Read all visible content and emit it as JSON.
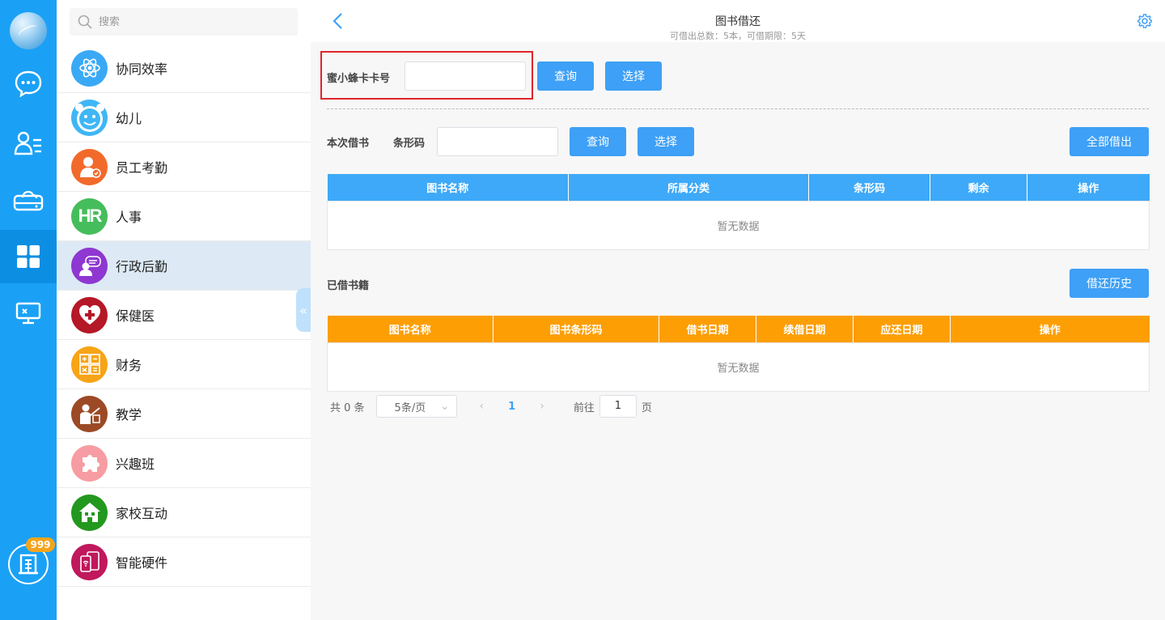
{
  "rail": {
    "items": [
      {
        "name": "chat",
        "icon": "chat-bubble-icon"
      },
      {
        "name": "contacts",
        "icon": "contacts-icon"
      },
      {
        "name": "cloud-drive",
        "icon": "cloud-drive-icon"
      },
      {
        "name": "apps",
        "icon": "apps-grid-icon",
        "active": true
      },
      {
        "name": "desktop",
        "icon": "monitor-icon"
      }
    ],
    "badge_count": "999"
  },
  "search": {
    "placeholder": "搜索"
  },
  "menu": {
    "items": [
      {
        "label": "协同效率",
        "color": "#3aa9f5",
        "icon": "atom-icon"
      },
      {
        "label": "幼儿",
        "color": "#3fb6f5",
        "icon": "smiley-icon"
      },
      {
        "label": "员工考勤",
        "color": "#f26a2b",
        "icon": "employee-icon"
      },
      {
        "label": "人事",
        "color": "#46bd5c",
        "icon": "hr-icon"
      },
      {
        "label": "行政后勤",
        "color": "#8e37d1",
        "icon": "admin-icon",
        "active": true
      },
      {
        "label": "保健医",
        "color": "#b51826",
        "icon": "heart-icon"
      },
      {
        "label": "财务",
        "color": "#f7a416",
        "icon": "calculator-icon"
      },
      {
        "label": "教学",
        "color": "#9c4a25",
        "icon": "teacher-icon"
      },
      {
        "label": "兴趣班",
        "color": "#f79ca2",
        "icon": "puzzle-icon"
      },
      {
        "label": "家校互动",
        "color": "#23981f",
        "icon": "home-icon"
      },
      {
        "label": "智能硬件",
        "color": "#c0185c",
        "icon": "device-icon"
      }
    ]
  },
  "header": {
    "title": "图书借还",
    "subtitle": "可借出总数：5本，可借期限：5天"
  },
  "card_section": {
    "label": "蜜小蜂卡卡号",
    "input_value": "",
    "query_label": "查询",
    "select_label": "选择"
  },
  "borrow_section": {
    "title": "本次借书",
    "barcode_label": "条形码",
    "input_value": "",
    "query_label": "查询",
    "select_label": "选择",
    "borrow_all_label": "全部借出",
    "columns": [
      "图书名称",
      "所属分类",
      "条形码",
      "剩余",
      "操作"
    ],
    "empty_text": "暂无数据"
  },
  "borrowed_section": {
    "title": "已借书籍",
    "history_label": "借还历史",
    "columns": [
      "图书名称",
      "图书条形码",
      "借书日期",
      "续借日期",
      "应还日期",
      "操作"
    ],
    "empty_text": "暂无数据"
  },
  "pager": {
    "total": "共 0 条",
    "page_size": "5条/页",
    "current_page": "1",
    "goto_label": "前往",
    "goto_value": "1",
    "page_suffix": "页"
  }
}
